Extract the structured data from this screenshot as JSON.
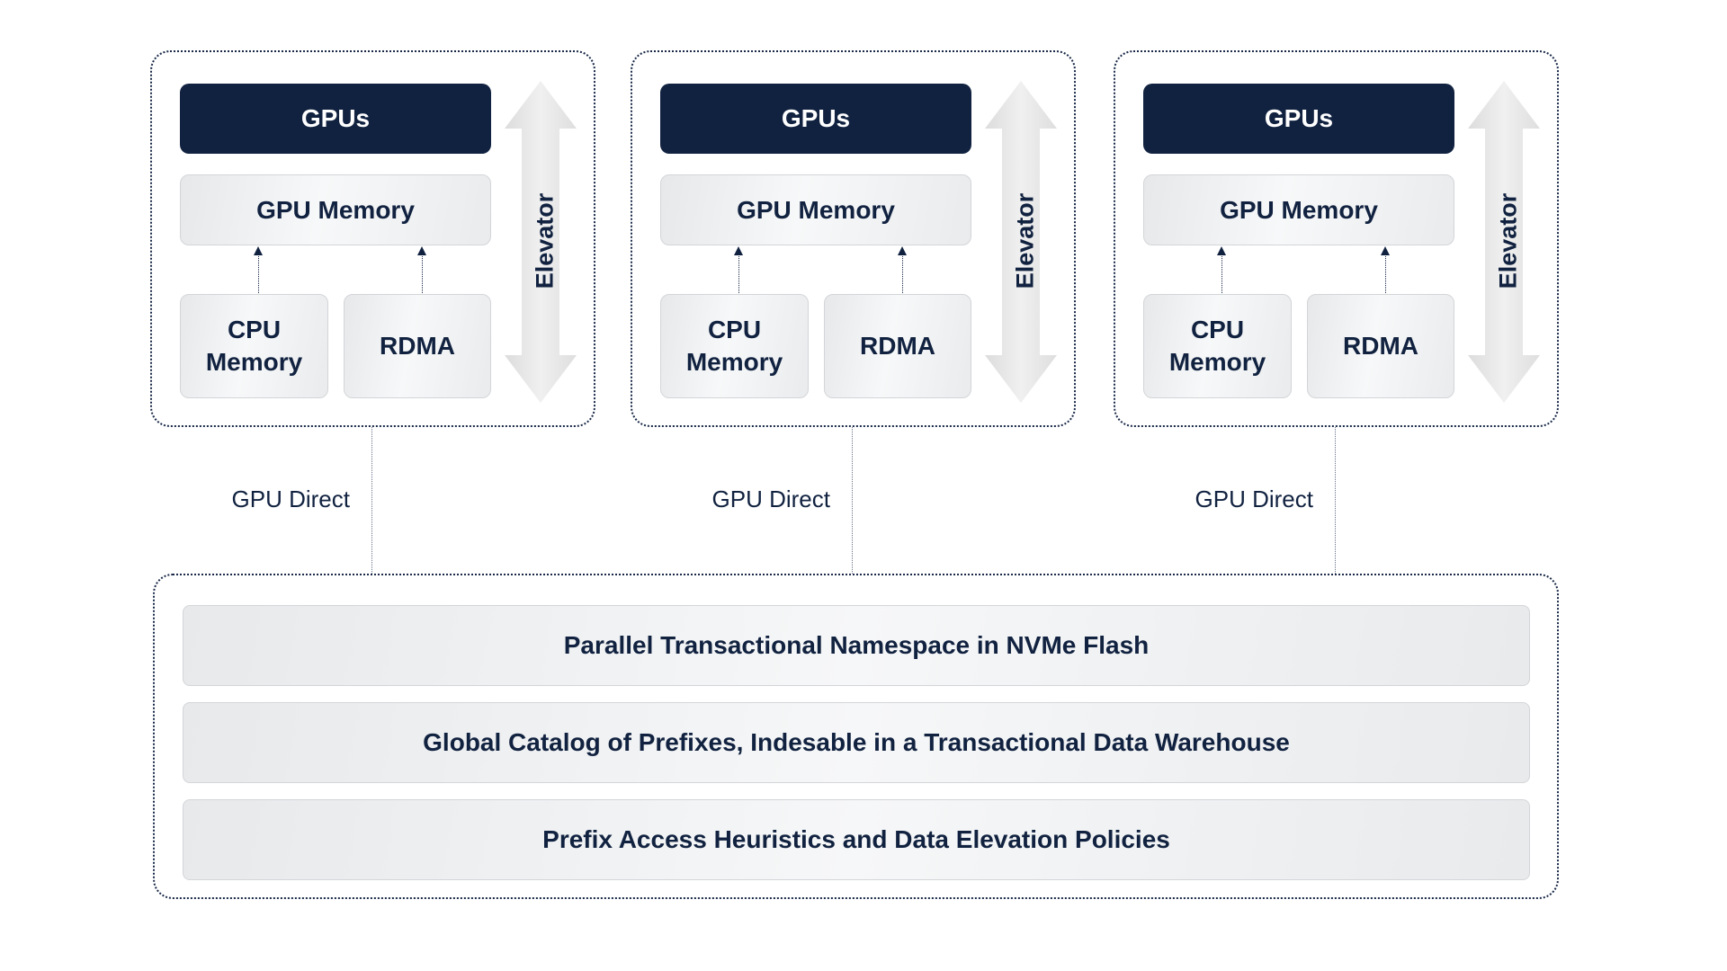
{
  "nodes": [
    {
      "gpus": "GPUs",
      "gpu_memory": "GPU Memory",
      "cpu_memory": "CPU Memory",
      "rdma": "RDMA",
      "elevator": "Elevator",
      "link": "GPU Direct"
    },
    {
      "gpus": "GPUs",
      "gpu_memory": "GPU Memory",
      "cpu_memory": "CPU Memory",
      "rdma": "RDMA",
      "elevator": "Elevator",
      "link": "GPU Direct"
    },
    {
      "gpus": "GPUs",
      "gpu_memory": "GPU Memory",
      "cpu_memory": "CPU Memory",
      "rdma": "RDMA",
      "elevator": "Elevator",
      "link": "GPU Direct"
    }
  ],
  "storage": {
    "layers": [
      "Parallel Transactional Namespace in NVMe Flash",
      "Global Catalog of Prefixes, Indesable in a Transactional Data Warehouse",
      "Prefix Access Heuristics and Data Elevation Policies"
    ]
  },
  "colors": {
    "navy": "#112240",
    "cell_gray": "#eceef0",
    "arrow_gray": "#e2e2e2"
  }
}
